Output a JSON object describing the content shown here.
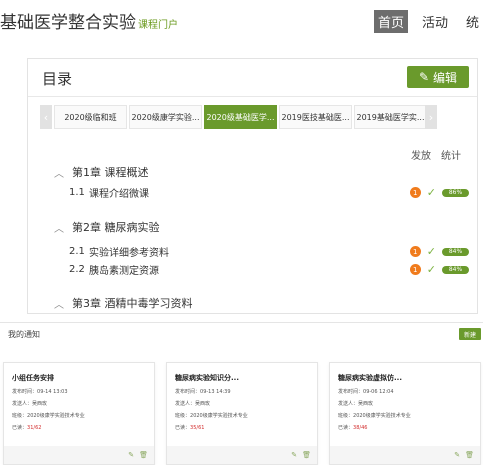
{
  "header": {
    "title": "基础医学整合实验",
    "subtitle": "课程门户",
    "nav": [
      "首页",
      "活动",
      "统"
    ]
  },
  "catalog": {
    "title": "目录",
    "edit_label": "编辑",
    "tabs": [
      "2020级临和班",
      "2020级康学实验...",
      "2020级基础医学...",
      "2019医技基础医...",
      "2019基础医学实..."
    ],
    "active_tab": 2,
    "col_publish": "发放",
    "col_stats": "统计",
    "chapters": [
      {
        "label": "第1章 课程概述",
        "lessons": [
          {
            "num": "1.1",
            "title": "课程介绍微课",
            "badge": "1",
            "pct": "86%"
          }
        ]
      },
      {
        "label": "第2章 糖尿病实验",
        "lessons": [
          {
            "num": "2.1",
            "title": "实验详细参考资料",
            "badge": "1",
            "pct": "84%"
          },
          {
            "num": "2.2",
            "title": "胰岛素测定资源",
            "badge": "1",
            "pct": "84%"
          }
        ]
      },
      {
        "label": "第3章 酒精中毒学习资料",
        "lessons": []
      }
    ]
  },
  "notifications": {
    "title": "我的通知",
    "new_label": "新建",
    "cards": [
      {
        "title": "小组任务安排",
        "time_label": "发布时间：",
        "time": "09-14 13:03",
        "sender_label": "发送人：",
        "sender": "吴西玫",
        "class_label": "班级：",
        "class": "2020级康学实验技术专业",
        "read_label": "已读：",
        "read": "31/62"
      },
      {
        "title": "糖尿病实验知识分...",
        "time_label": "发布时间：",
        "time": "09-13 14:39",
        "sender_label": "发送人：",
        "sender": "吴西玫",
        "class_label": "班级：",
        "class": "2020级康学实验技术专业",
        "read_label": "已读：",
        "read": "35/61"
      },
      {
        "title": "糖尿病实验虚拟仿...",
        "time_label": "发布时间：",
        "time": "09-06 12:04",
        "sender_label": "发送人：",
        "sender": "吴西玫",
        "class_label": "班级：",
        "class": "2020级康学实验技术专业",
        "read_label": "已读：",
        "read": "38/46"
      }
    ]
  }
}
